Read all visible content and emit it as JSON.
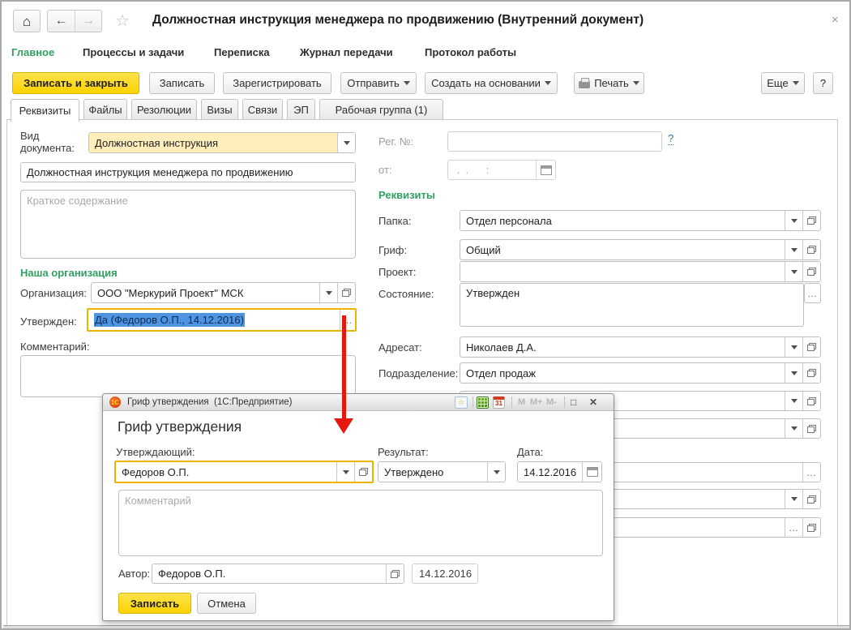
{
  "window": {
    "title": "Должностная инструкция менеджера по продвижению (Внутренний документ)",
    "close": "×",
    "home_icon": "⌂",
    "back_icon": "←",
    "forward_icon": "→",
    "star_icon": "☆"
  },
  "menu": {
    "items": [
      {
        "label": "Главное",
        "active": true
      },
      {
        "label": "Процессы и задачи",
        "active": false
      },
      {
        "label": "Переписка",
        "active": false
      },
      {
        "label": "Журнал передачи",
        "active": false
      },
      {
        "label": "Протокол работы",
        "active": false
      }
    ]
  },
  "toolbar": {
    "save_close": "Записать и закрыть",
    "save": "Записать",
    "register": "Зарегистрировать",
    "send": "Отправить",
    "create_from": "Создать на основании",
    "print": "Печать",
    "more": "Еще",
    "help": "?"
  },
  "tabs": {
    "items": [
      {
        "label": "Реквизиты"
      },
      {
        "label": "Файлы"
      },
      {
        "label": "Резолюции"
      },
      {
        "label": "Визы"
      },
      {
        "label": "Связи"
      },
      {
        "label": "ЭП"
      },
      {
        "label": "Рабочая группа (1)"
      }
    ]
  },
  "form": {
    "doc_type": {
      "label": "Вид документа:",
      "value": "Должностная инструкция"
    },
    "name": {
      "value": "Должностная инструкция менеджера по продвижению"
    },
    "summary": {
      "placeholder": "Краткое содержание"
    },
    "org_section": "Наша организация",
    "organization": {
      "label": "Организация:",
      "value": "ООО \"Меркурий Проект\" МСК"
    },
    "approved": {
      "label": "Утвержден:",
      "value": "Да (Федоров О.П., 14.12.2016)",
      "dots": "…"
    },
    "comment": {
      "label": "Комментарий:"
    },
    "reg": {
      "label": "Рег. №:",
      "help": "?"
    },
    "from": {
      "label": "от:",
      "placeholder": " .  .      :"
    },
    "props_section": "Реквизиты",
    "folder": {
      "label": "Папка:",
      "value": "Отдел персонала"
    },
    "stamp": {
      "label": "Гриф:",
      "value": "Общий"
    },
    "project": {
      "label": "Проект:",
      "value": ""
    },
    "state": {
      "label": "Состояние:",
      "value": "Утвержден",
      "dots": "…"
    },
    "addressee": {
      "label": "Адресат:",
      "value": "Николаев Д.А."
    },
    "department": {
      "label": "Подразделение:",
      "value": "Отдел продаж"
    }
  },
  "dialog": {
    "titlebar": {
      "logo": "1С",
      "title": "Гриф утверждения  (1С:Предприятие)",
      "star": "☆",
      "calendar_day": "31",
      "m": "M",
      "m_plus": "M+",
      "m_minus": "M-",
      "maximize": "□",
      "close": "✕"
    },
    "heading": "Гриф утверждения",
    "approver": {
      "label": "Утверждающий:",
      "value": "Федоров О.П."
    },
    "result": {
      "label": "Результат:",
      "value": "Утверждено"
    },
    "date": {
      "label": "Дата:",
      "value": "14.12.2016"
    },
    "comment": {
      "placeholder": "Комментарий"
    },
    "author": {
      "label": "Автор:",
      "value": "Федоров О.П.",
      "date": "14.12.2016"
    },
    "buttons": {
      "save": "Записать",
      "cancel": "Отмена"
    }
  },
  "colors": {
    "accent_yellow": "#fcd200",
    "green": "#31a061",
    "focus_border": "#eeb200",
    "selection_blue": "#4f94e0",
    "arrow_red": "#e4180c",
    "combo_yellow_bg": "#ffeebb"
  }
}
